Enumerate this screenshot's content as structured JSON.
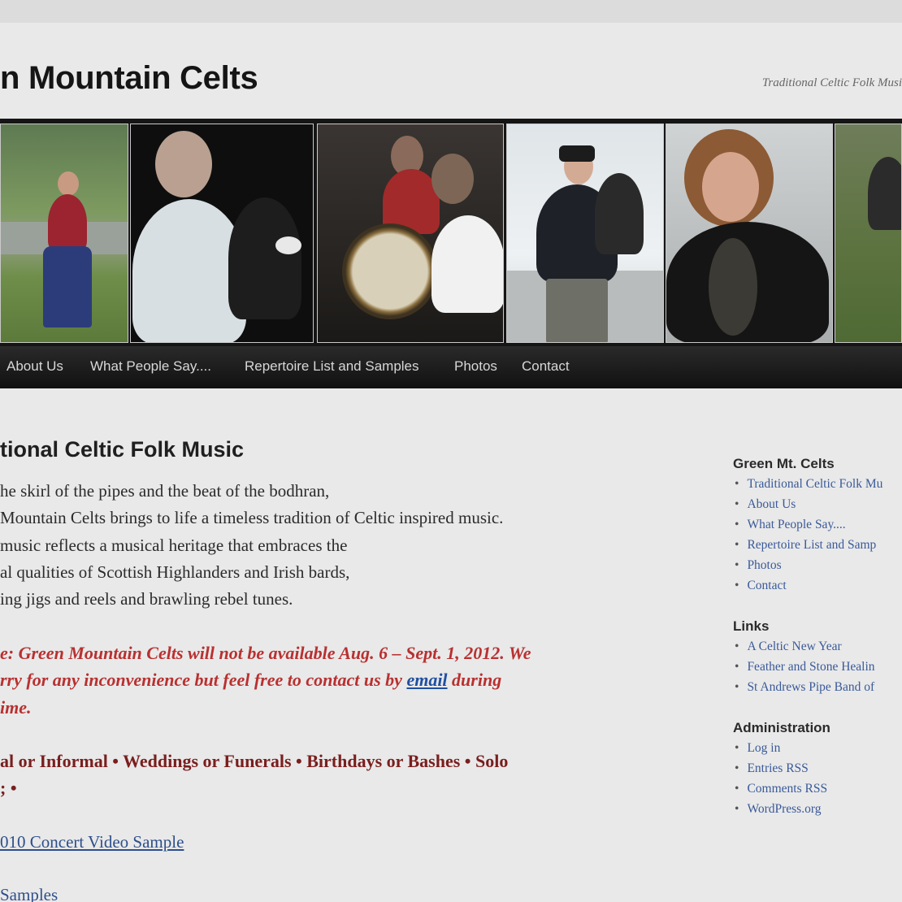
{
  "header": {
    "site_title": "n Mountain Celts",
    "tagline": "Traditional Celtic Folk Musi"
  },
  "nav": {
    "items": [
      "About Us",
      "What People Say....",
      "Repertoire List and Samples",
      "Photos",
      "Contact"
    ]
  },
  "content": {
    "title": "tional Celtic Folk Music",
    "intro_lines": [
      "he skirl of the pipes and the beat of the bodhran,",
      "Mountain Celts brings to life a timeless tradition of Celtic inspired music.",
      "music reflects a musical heritage that embraces the",
      "al qualities of Scottish Highlanders and Irish bards,",
      "ing jigs and reels and brawling rebel tunes."
    ],
    "notice": {
      "line1": "e: Green Mountain Celts will not be available Aug. 6 – Sept. 1, 2012. We",
      "line2_before": "rry for any inconvenience but feel free to contact us by ",
      "line2_link": "email",
      "line2_after": " during",
      "line3": "ime."
    },
    "events_line1": "al or Informal • Weddings or Funerals • Birthdays or Bashes • Solo",
    "events_line2": "; •",
    "video_link": "010 Concert Video Sample",
    "samples_link": "Samples"
  },
  "sidebar": {
    "widgets": [
      {
        "title": "Green Mt. Celts",
        "items": [
          "Traditional Celtic Folk Mu",
          "About Us",
          "What People Say....",
          "Repertoire List and Samp",
          "Photos",
          "Contact"
        ]
      },
      {
        "title": "Links",
        "items": [
          "A Celtic New Year",
          "Feather and Stone Healin",
          "St Andrews Pipe Band of"
        ]
      },
      {
        "title": "Administration",
        "items": [
          "Log in",
          "Entries RSS",
          "Comments RSS",
          "WordPress.org"
        ]
      }
    ]
  },
  "colors": {
    "notice": "#b93030",
    "link": "#2d4f8a",
    "nav_bg": "#151515"
  }
}
